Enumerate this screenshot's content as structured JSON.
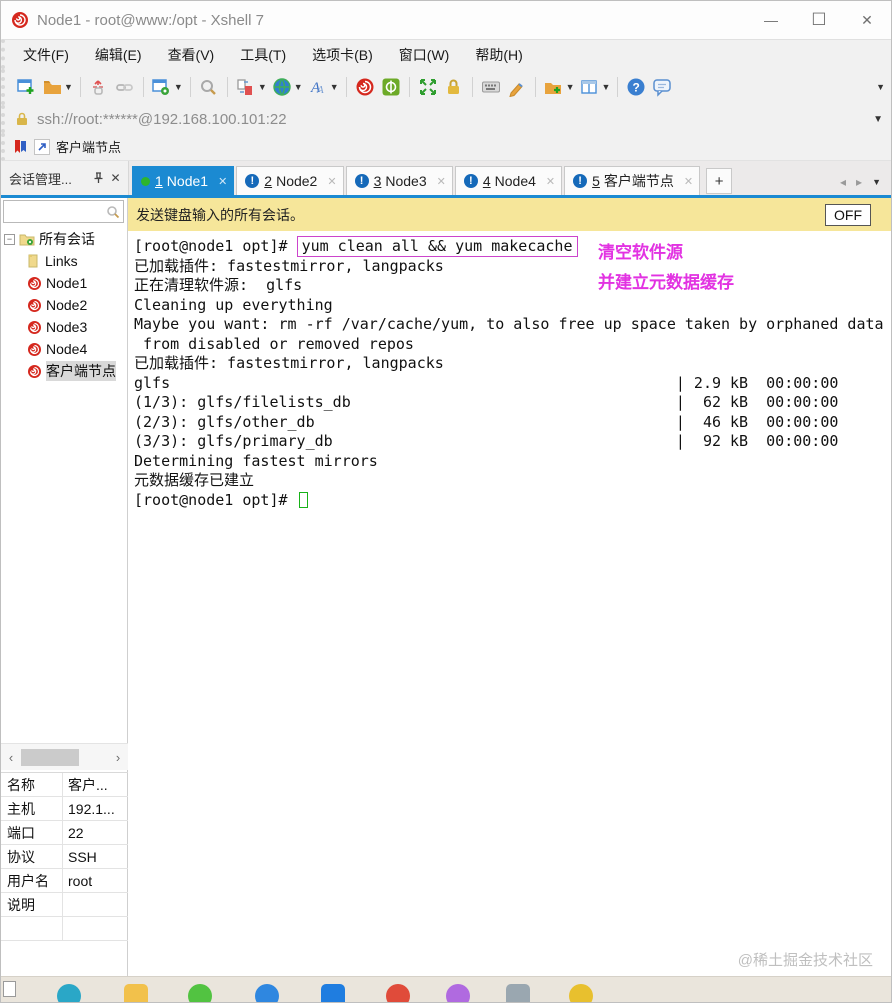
{
  "window": {
    "title": "Node1 - root@www:/opt - Xshell 7",
    "controls": {
      "minimize": "—",
      "maximize": "☐",
      "close": "✕"
    }
  },
  "menu": {
    "items": [
      "文件(F)",
      "编辑(E)",
      "查看(V)",
      "工具(T)",
      "选项卡(B)",
      "窗口(W)",
      "帮助(H)"
    ]
  },
  "toolbar": {
    "icons": [
      "new-session",
      "open",
      "disconnect",
      "reconnect",
      "session-properties",
      "find",
      "new-file-transfer",
      "web",
      "font",
      "xshell",
      "xftp",
      "full-screen",
      "lock-screen",
      "virtual-keyboard",
      "compose",
      "new-folder",
      "tile-windows",
      "help",
      "chat"
    ]
  },
  "address": {
    "url": "ssh://root:******@192.168.100.101:22"
  },
  "bookmarks": {
    "item": "客户端节点"
  },
  "panel": {
    "title": "会话管理..."
  },
  "tabs": {
    "items": [
      {
        "num": "1",
        "label": "Node1"
      },
      {
        "num": "2",
        "label": "Node2"
      },
      {
        "num": "3",
        "label": "Node3"
      },
      {
        "num": "4",
        "label": "Node4"
      },
      {
        "num": "5",
        "label": "客户端节点"
      }
    ],
    "new_tab": "+"
  },
  "sidebar": {
    "tree_root": "所有会话",
    "items": [
      "Links",
      "Node1",
      "Node2",
      "Node3",
      "Node4",
      "客户端节点"
    ],
    "properties": [
      {
        "key": "名称",
        "value": "客户..."
      },
      {
        "key": "主机",
        "value": "192.1..."
      },
      {
        "key": "端口",
        "value": "22"
      },
      {
        "key": "协议",
        "value": "SSH"
      },
      {
        "key": "用户名",
        "value": "root"
      },
      {
        "key": "说明",
        "value": ""
      }
    ]
  },
  "broadcast": {
    "text": "发送键盘输入的所有会话。",
    "button": "OFF"
  },
  "terminal": {
    "prompt1": "[root@node1 opt]# ",
    "command1": "yum clean all && yum makecache",
    "lines": [
      "已加载插件: fastestmirror, langpacks",
      "正在清理软件源:  glfs",
      "Cleaning up everything",
      "Maybe you want: rm -rf /var/cache/yum, to also free up space taken by orphaned data",
      " from disabled or removed repos",
      "已加载插件: fastestmirror, langpacks",
      "glfs                                                        | 2.9 kB  00:00:00",
      "(1/3): glfs/filelists_db                                    |  62 kB  00:00:00",
      "(2/3): glfs/other_db                                        |  46 kB  00:00:00",
      "(3/3): glfs/primary_db                                      |  92 kB  00:00:00",
      "Determining fastest mirrors",
      "元数据缓存已建立"
    ],
    "prompt2": "[root@node1 opt]# ",
    "annotation1": "清空软件源",
    "annotation2": "并建立元数据缓存"
  },
  "watermark": "@稀土掘金技术社区",
  "colors": {
    "accent_blue": "#1b8ad2",
    "broadcast_yellow": "#f6e69a",
    "annotation_magenta": "#e232e2",
    "cursor_green": "#18b218",
    "xshell_red": "#d5281e"
  },
  "dock": {
    "icons": [
      {
        "name": "browser-teal",
        "color": "#2aa7c7"
      },
      {
        "name": "folder-yellow",
        "color": "#f2c14b"
      },
      {
        "name": "messenger-green",
        "color": "#52c341"
      },
      {
        "name": "app-blue",
        "color": "#2f87e0"
      },
      {
        "name": "remote-blue-square",
        "color": "#1f7de0"
      },
      {
        "name": "app-red",
        "color": "#e04b3a"
      },
      {
        "name": "app-purple",
        "color": "#b06ae0"
      },
      {
        "name": "notepad-gray",
        "color": "#9aa7b0"
      },
      {
        "name": "office-yellow",
        "color": "#e8c02e"
      }
    ]
  }
}
